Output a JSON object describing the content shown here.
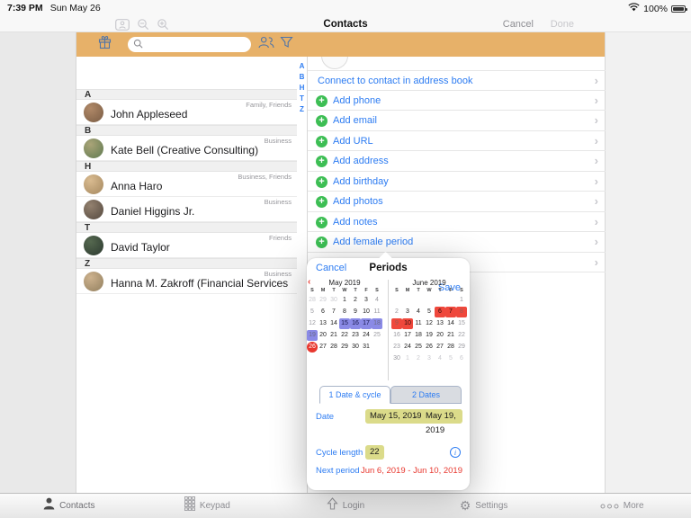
{
  "colors": {
    "accent_blue": "#2D7CF2",
    "toolbar_orange": "#E7B169",
    "add_green": "#3DBE54",
    "period_purple": "#8A8AE6",
    "next_period_red": "#EF483C",
    "today_red": "#E8382F",
    "badge_khaki": "#DBDB8A"
  },
  "status_bar": {
    "time": "7:39 PM",
    "date": "Sun May 26",
    "battery_percent": "100%"
  },
  "nav_bar": {
    "title": "Contacts",
    "cancel": "Cancel",
    "done": "Done",
    "icons": [
      "contact-card-icon",
      "zoom-out-icon",
      "zoom-in-icon"
    ]
  },
  "toolbar": {
    "icons": [
      "gift-icon",
      "search-icon",
      "people-icon",
      "filter-icon"
    ],
    "search_placeholder": ""
  },
  "contact_list": {
    "index": [
      "A",
      "B",
      "H",
      "T",
      "Z"
    ],
    "sections": [
      {
        "letter": "A",
        "contacts": [
          {
            "name": "John Appleseed",
            "tags": "Family, Friends",
            "avatar": [
              "#b08968",
              "#7a5c44"
            ]
          }
        ]
      },
      {
        "letter": "B",
        "contacts": [
          {
            "name": "Kate Bell (Creative Consulting)",
            "tags": "Business",
            "avatar": [
              "#aaa478",
              "#5f7a50"
            ]
          }
        ]
      },
      {
        "letter": "H",
        "contacts": [
          {
            "name": "Anna Haro",
            "tags": "Business, Friends",
            "avatar": [
              "#d9bb90",
              "#a5885f"
            ]
          },
          {
            "name": "Daniel Higgins Jr.",
            "tags": "Business",
            "avatar": [
              "#93816f",
              "#55493f"
            ]
          }
        ]
      },
      {
        "letter": "T",
        "contacts": [
          {
            "name": "David Taylor",
            "tags": "Friends",
            "avatar": [
              "#55684f",
              "#2c3a30"
            ]
          }
        ]
      },
      {
        "letter": "Z",
        "contacts": [
          {
            "name": "Hanna M. Zakroff (Financial Services I…",
            "tags": "Business",
            "avatar": [
              "#cdb28e",
              "#93805f"
            ]
          }
        ]
      }
    ]
  },
  "detail_panel": {
    "rows": [
      {
        "label": "Connect to contact in address book",
        "plus": false
      },
      {
        "label": "Add phone",
        "plus": true
      },
      {
        "label": "Add email",
        "plus": true
      },
      {
        "label": "Add URL",
        "plus": true
      },
      {
        "label": "Add address",
        "plus": true
      },
      {
        "label": "Add birthday",
        "plus": true
      },
      {
        "label": "Add photos",
        "plus": true
      },
      {
        "label": "Add notes",
        "plus": true
      },
      {
        "label": "Add female period",
        "plus": true
      },
      {
        "label": "",
        "plus": false
      }
    ]
  },
  "periods_popup": {
    "cancel": "Cancel",
    "title": "Periods",
    "save": "Save",
    "prev_month_arrow": "‹",
    "weekdays": [
      "S",
      "M",
      "T",
      "W",
      "T",
      "F",
      "S"
    ],
    "months": [
      {
        "name": "May 2019",
        "weeks": [
          [
            {
              "d": 28,
              "s": "out"
            },
            {
              "d": 29,
              "s": "out"
            },
            {
              "d": 30,
              "s": "out"
            },
            {
              "d": 1,
              "s": ""
            },
            {
              "d": 2,
              "s": ""
            },
            {
              "d": 3,
              "s": ""
            },
            {
              "d": 4,
              "s": "wk"
            }
          ],
          [
            {
              "d": 5,
              "s": "wk"
            },
            {
              "d": 6,
              "s": ""
            },
            {
              "d": 7,
              "s": ""
            },
            {
              "d": 8,
              "s": ""
            },
            {
              "d": 9,
              "s": ""
            },
            {
              "d": 10,
              "s": ""
            },
            {
              "d": 11,
              "s": "wk"
            }
          ],
          [
            {
              "d": 12,
              "s": "wk"
            },
            {
              "d": 13,
              "s": ""
            },
            {
              "d": 14,
              "s": ""
            },
            {
              "d": 15,
              "s": "period"
            },
            {
              "d": 16,
              "s": "period"
            },
            {
              "d": 17,
              "s": "period"
            },
            {
              "d": 18,
              "s": "period-wk"
            }
          ],
          [
            {
              "d": 19,
              "s": "period-wk"
            },
            {
              "d": 20,
              "s": ""
            },
            {
              "d": 21,
              "s": ""
            },
            {
              "d": 22,
              "s": ""
            },
            {
              "d": 23,
              "s": ""
            },
            {
              "d": 24,
              "s": ""
            },
            {
              "d": 25,
              "s": "wk"
            }
          ],
          [
            {
              "d": 26,
              "s": "today"
            },
            {
              "d": 27,
              "s": ""
            },
            {
              "d": 28,
              "s": ""
            },
            {
              "d": 29,
              "s": ""
            },
            {
              "d": 30,
              "s": ""
            },
            {
              "d": 31,
              "s": ""
            },
            {
              "d": "",
              "s": ""
            }
          ],
          [
            {
              "d": "",
              "s": ""
            },
            {
              "d": "",
              "s": ""
            },
            {
              "d": "",
              "s": ""
            },
            {
              "d": "",
              "s": ""
            },
            {
              "d": "",
              "s": ""
            },
            {
              "d": "",
              "s": ""
            },
            {
              "d": "",
              "s": ""
            }
          ]
        ]
      },
      {
        "name": "June 2019",
        "weeks": [
          [
            {
              "d": "",
              "s": ""
            },
            {
              "d": "",
              "s": ""
            },
            {
              "d": "",
              "s": ""
            },
            {
              "d": "",
              "s": ""
            },
            {
              "d": "",
              "s": ""
            },
            {
              "d": "",
              "s": ""
            },
            {
              "d": 1,
              "s": "wk"
            }
          ],
          [
            {
              "d": 2,
              "s": "wk"
            },
            {
              "d": 3,
              "s": ""
            },
            {
              "d": 4,
              "s": ""
            },
            {
              "d": 5,
              "s": ""
            },
            {
              "d": 6,
              "s": "next"
            },
            {
              "d": 7,
              "s": "next"
            },
            {
              "d": 8,
              "s": "next-wk"
            }
          ],
          [
            {
              "d": 9,
              "s": "next-wk"
            },
            {
              "d": 10,
              "s": "next"
            },
            {
              "d": 11,
              "s": ""
            },
            {
              "d": 12,
              "s": ""
            },
            {
              "d": 13,
              "s": ""
            },
            {
              "d": 14,
              "s": ""
            },
            {
              "d": 15,
              "s": "wk"
            }
          ],
          [
            {
              "d": 16,
              "s": "wk"
            },
            {
              "d": 17,
              "s": ""
            },
            {
              "d": 18,
              "s": ""
            },
            {
              "d": 19,
              "s": ""
            },
            {
              "d": 20,
              "s": ""
            },
            {
              "d": 21,
              "s": ""
            },
            {
              "d": 22,
              "s": "wk"
            }
          ],
          [
            {
              "d": 23,
              "s": "wk"
            },
            {
              "d": 24,
              "s": ""
            },
            {
              "d": 25,
              "s": ""
            },
            {
              "d": 26,
              "s": ""
            },
            {
              "d": 27,
              "s": ""
            },
            {
              "d": 28,
              "s": ""
            },
            {
              "d": 29,
              "s": "wk"
            }
          ],
          [
            {
              "d": 30,
              "s": "wk"
            },
            {
              "d": 1,
              "s": "out"
            },
            {
              "d": 2,
              "s": "out"
            },
            {
              "d": 3,
              "s": "out"
            },
            {
              "d": 4,
              "s": "out"
            },
            {
              "d": 5,
              "s": "out"
            },
            {
              "d": 6,
              "s": "out"
            }
          ]
        ]
      }
    ],
    "tabs": [
      {
        "label": "1 Date & cycle",
        "active": true
      },
      {
        "label": "2 Dates",
        "active": false
      }
    ],
    "date_row": {
      "label": "Date",
      "from": "May 15, 2019",
      "sep": "-",
      "to": "May 19, 2019"
    },
    "cycle_row": {
      "label": "Cycle length",
      "value": "22",
      "info_icon": "i"
    },
    "next_row": {
      "label": "Next period",
      "value": "Jun 6, 2019  -  Jun 10, 2019"
    }
  },
  "tab_bar": {
    "items": [
      {
        "label": "Contacts",
        "icon": "person-icon",
        "active": true
      },
      {
        "label": "Keypad",
        "icon": "keypad-icon",
        "active": false
      },
      {
        "label": "Login",
        "icon": "login-arrow-icon",
        "active": false
      },
      {
        "label": "Settings",
        "icon": "gear-icon",
        "active": false
      },
      {
        "label": "More",
        "icon": "more-dots-icon",
        "active": false
      }
    ]
  }
}
